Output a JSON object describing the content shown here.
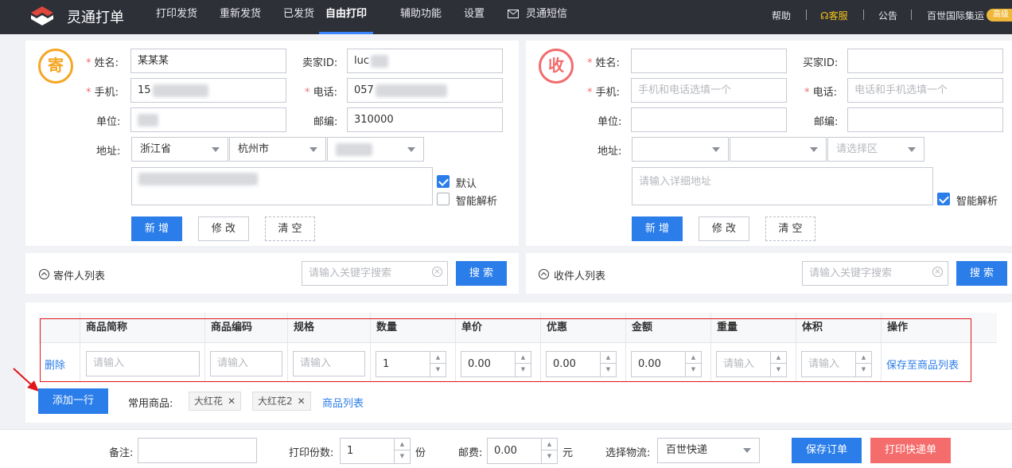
{
  "nav": {
    "brand": "灵通打单",
    "items": [
      "打印发货",
      "重新发货",
      "已发货",
      "自由打印",
      "辅助功能",
      "设置"
    ],
    "active": "自由打印",
    "sms": "灵通短信",
    "help": "帮助",
    "service": "客服",
    "notice": "公告",
    "company": "百世国际集运",
    "badge": "高级"
  },
  "sender": {
    "badge": "寄",
    "name_label": "姓名:",
    "name_value": "某某某",
    "seller_label": "卖家ID:",
    "seller_value": "luc",
    "mobile_label": "手机:",
    "mobile_value": "15",
    "phone_label": "电话:",
    "phone_value": "057",
    "unit_label": "单位:",
    "zip_label": "邮编:",
    "zip_value": "310000",
    "addr_label": "地址:",
    "province": "浙江省",
    "city": "杭州市",
    "default_label": "默认",
    "parse_label": "智能解析",
    "btn_add": "新 增",
    "btn_edit": "修 改",
    "btn_clear": "清 空",
    "list_title": "寄件人列表",
    "search_placeholder": "请输入关键字搜索",
    "search_btn": "搜 索"
  },
  "receiver": {
    "badge": "收",
    "name_label": "姓名:",
    "buyer_label": "买家ID:",
    "mobile_label": "手机:",
    "mobile_placeholder": "手机和电话选填一个",
    "phone_label": "电话:",
    "phone_placeholder": "电话和手机选填一个",
    "unit_label": "单位:",
    "zip_label": "邮编:",
    "addr_label": "地址:",
    "district_placeholder": "请选择区",
    "detail_placeholder": "请输入详细地址",
    "parse_label": "智能解析",
    "btn_add": "新 增",
    "btn_edit": "修 改",
    "btn_clear": "清 空",
    "list_title": "收件人列表",
    "search_placeholder": "请输入关键字搜索",
    "search_btn": "搜 索"
  },
  "goods": {
    "headers": [
      "商品简称",
      "商品编码",
      "规格",
      "数量",
      "单价",
      "优惠",
      "金额",
      "重量",
      "体积",
      "操作"
    ],
    "row": {
      "delete": "删除",
      "placeholder": "请输入",
      "qty": "1",
      "price": "0.00",
      "discount": "0.00",
      "amount": "0.00",
      "save_link": "保存至商品列表"
    },
    "add_row_btn": "添加一行",
    "common_label": "常用商品:",
    "tags": [
      "大红花",
      "大红花2"
    ],
    "goods_list_link": "商品列表"
  },
  "footer": {
    "remark_label": "备注:",
    "copies_label": "打印份数:",
    "copies_value": "1",
    "copies_unit": "份",
    "postage_label": "邮费:",
    "postage_value": "0.00",
    "postage_unit": "元",
    "logistics_label": "选择物流:",
    "logistics_value": "百世快递",
    "save_btn": "保存订单",
    "print_btn": "打印快递单"
  },
  "colors": {
    "nav_bg": "#2e3038",
    "primary": "#2b7de9",
    "danger": "#f56c6c",
    "sender_badge": "#f5a623",
    "receiver_badge": "#f26b6b",
    "highlight_box": "#e0161b"
  }
}
